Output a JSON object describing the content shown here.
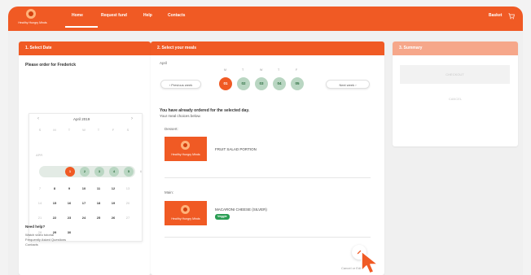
{
  "brand": {
    "logo_text": "Healthy Hungry Minds"
  },
  "nav": {
    "home": "Home",
    "request_fund": "Request fund",
    "help": "Help",
    "contacts": "Contacts",
    "basket": "Basket"
  },
  "step1": {
    "title": "1. Select Date",
    "order_for": "Please order for Frederick",
    "calendar": {
      "month": "April 2019",
      "prev": "‹",
      "next": "›",
      "weekdays": [
        "S",
        "M",
        "T",
        "W",
        "T",
        "F",
        "S"
      ],
      "week_label": "APR",
      "rows": [
        [
          "",
          "1",
          "2",
          "3",
          "4",
          "5",
          "6"
        ],
        [
          "7",
          "8",
          "9",
          "10",
          "11",
          "12",
          "13"
        ],
        [
          "14",
          "15",
          "16",
          "17",
          "18",
          "19",
          "20"
        ],
        [
          "21",
          "22",
          "23",
          "24",
          "25",
          "26",
          "27"
        ],
        [
          "28",
          "29",
          "30",
          "",
          "",
          "",
          ""
        ]
      ]
    },
    "help": {
      "title": "Need help?",
      "links": [
        "Watch video tutorial",
        "Frequently Asked Questions",
        "Contacts"
      ]
    }
  },
  "step2": {
    "title": "2. Select your meals",
    "month": "April",
    "weekday_letters": [
      "M",
      "T",
      "W",
      "T",
      "F"
    ],
    "dates": [
      "01",
      "02",
      "03",
      "04",
      "05"
    ],
    "prev_week": "‹ Previous week",
    "next_week": "Next week ›",
    "notice_bold": "You have already ordered for the selected day.",
    "notice_sub": "Your meal choices below.",
    "dessert_label": "Dessert:",
    "dessert_item": "FRUIT SALAD PORTION",
    "main_label": "Main:",
    "main_item": "MACARONI CHEESE (SILVER)",
    "veggie_tag": "Veggie",
    "cancel_edit": "Cancel or Edit"
  },
  "step3": {
    "title": "3. Summary",
    "checkout": "CHECKOUT",
    "cancel": "CANCEL"
  },
  "colors": {
    "brand_orange": "#f05a24",
    "veggie_green": "#2a9d53",
    "chip_green": "#b9d6c2"
  }
}
